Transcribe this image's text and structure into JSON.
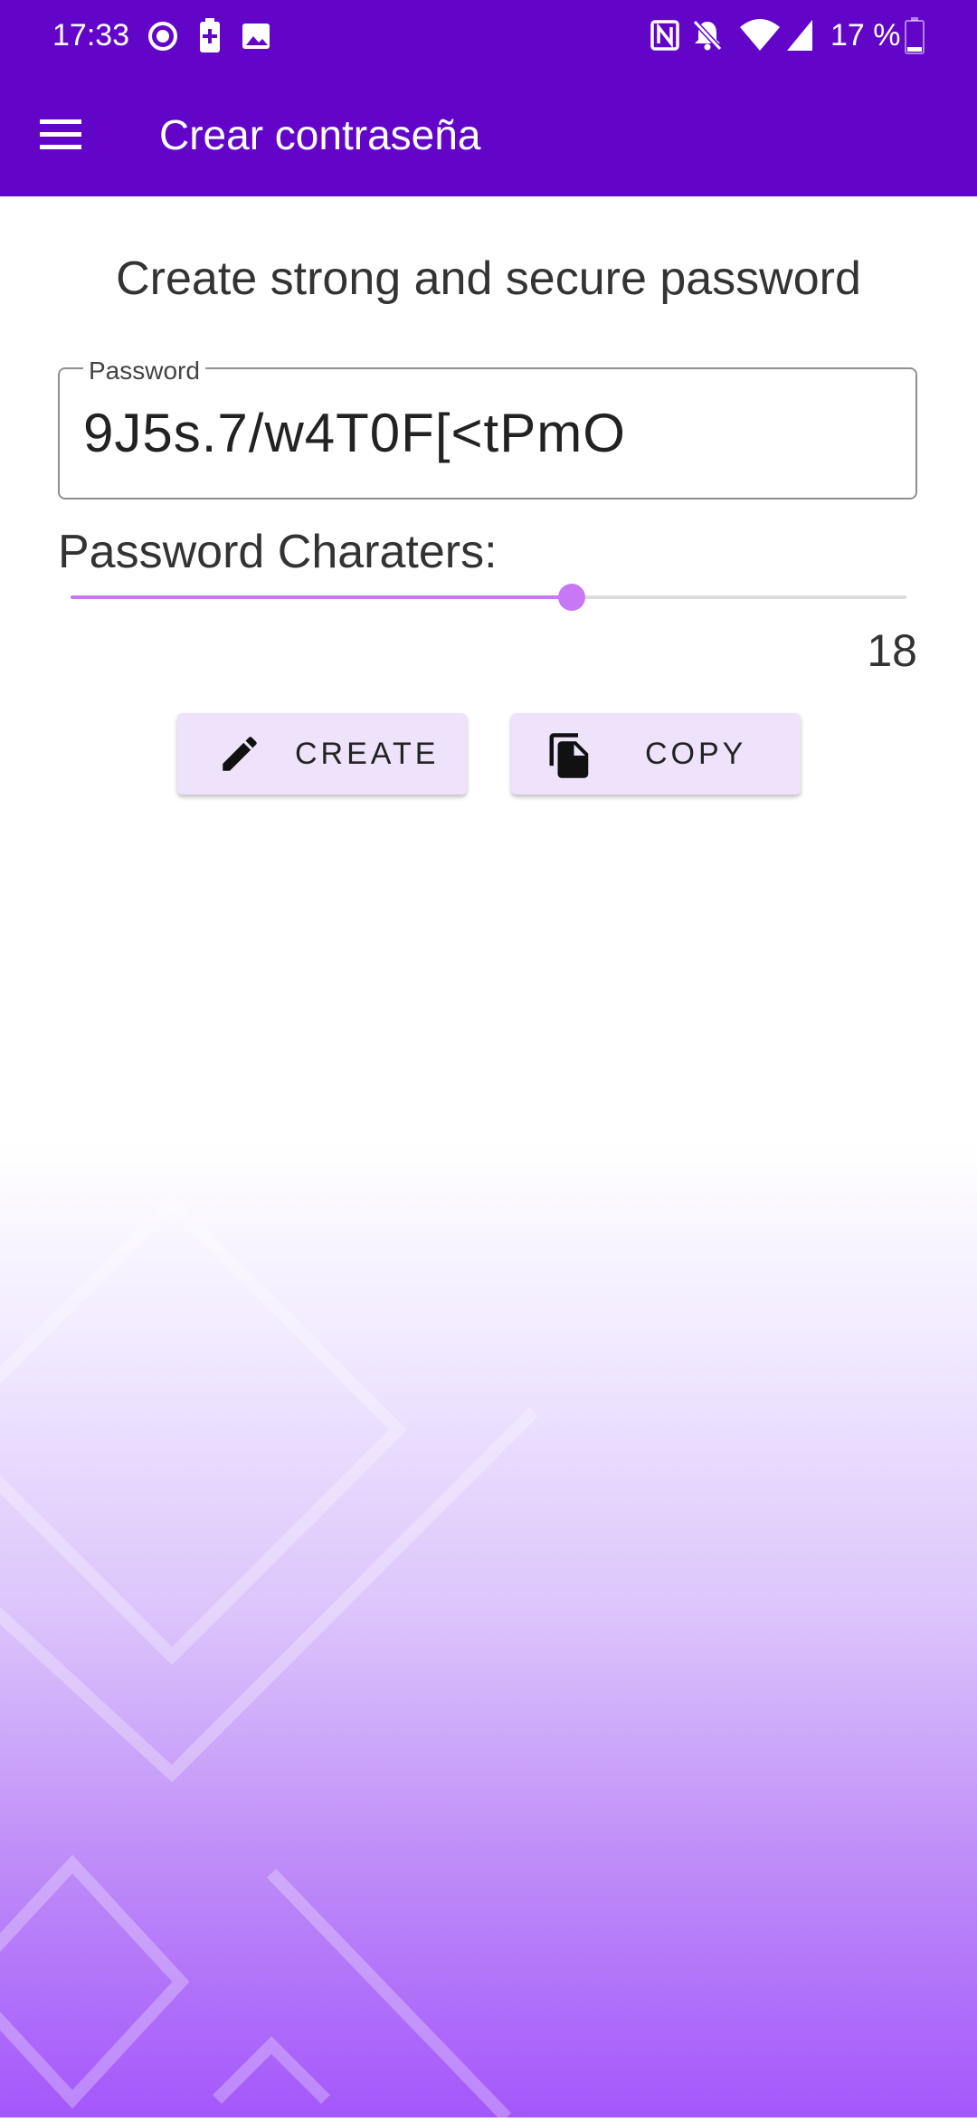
{
  "status_bar": {
    "time": "17:33",
    "battery_text": "17 %",
    "icons": [
      "record-icon",
      "battery-saver-icon",
      "image-icon",
      "nfc-icon",
      "notifications-off-icon",
      "wifi-icon",
      "signal-icon",
      "battery-icon"
    ]
  },
  "app_bar": {
    "title": "Crear contraseña",
    "menu_icon": "hamburger-menu-icon"
  },
  "main": {
    "heading": "Create strong and secure password",
    "password_field": {
      "label": "Password",
      "value": "9J5s.7/w4T0F[<tPmO"
    },
    "length_slider": {
      "label": "Password Charaters:",
      "value": "18",
      "fraction": 0.6
    },
    "buttons": {
      "create_label": "CREATE",
      "copy_label": "COPY"
    }
  },
  "colors": {
    "primary": "#6305c8",
    "accent": "#c978f5",
    "button_bg": "#eee3fb",
    "gradient_end": "#a457fb"
  }
}
